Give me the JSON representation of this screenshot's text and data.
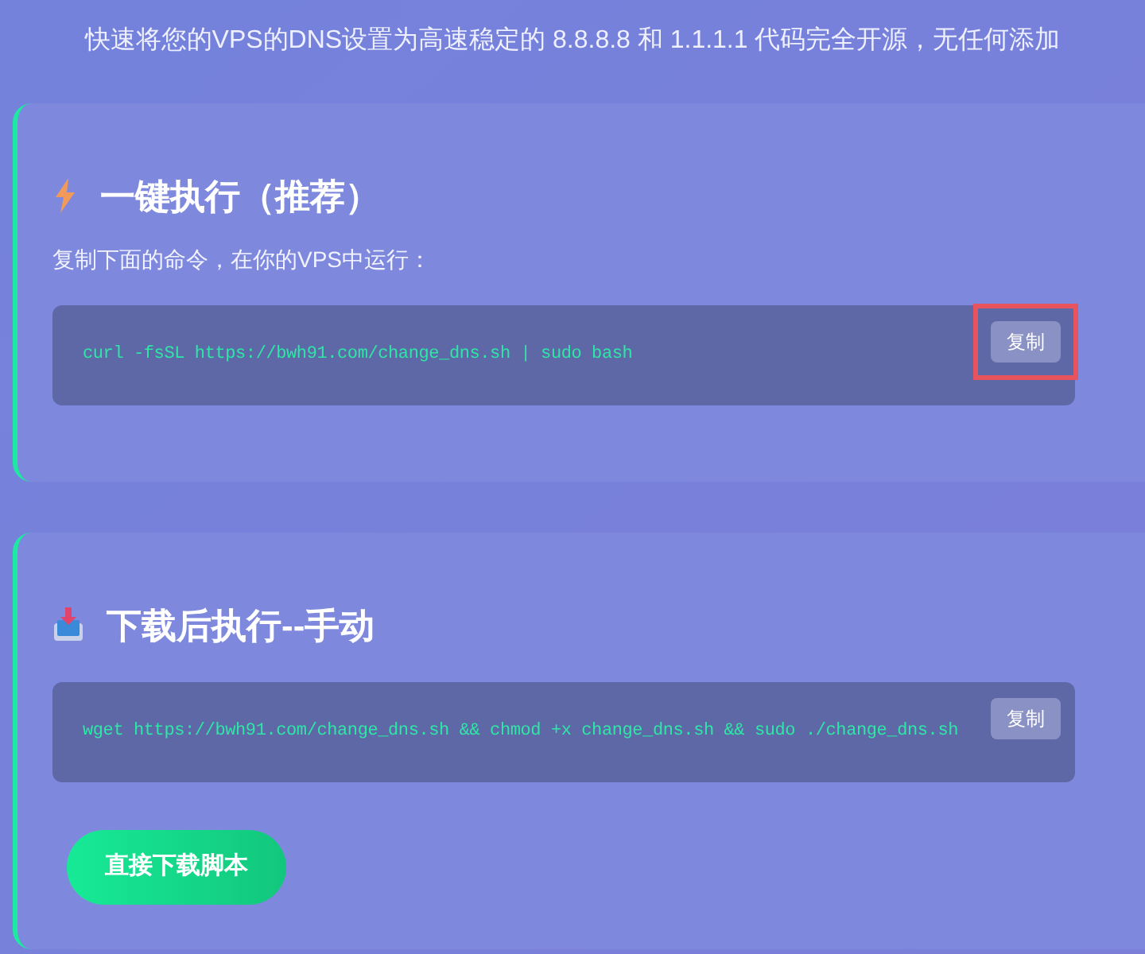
{
  "subtitle": "快速将您的VPS的DNS设置为高速稳定的 8.8.8.8 和 1.1.1.1 代码完全开源，无任何添加",
  "sections": [
    {
      "kind": "oneclick",
      "title": "一键执行（推荐）",
      "description": "复制下面的命令，在你的VPS中运行：",
      "command": "curl -fsSL https://bwh91.com/change_dns.sh | sudo bash",
      "copy": {
        "label": "复制",
        "highlighted": true
      }
    },
    {
      "kind": "manual",
      "title": "下载后执行--手动",
      "command": "wget https://bwh91.com/change_dns.sh && chmod +x change_dns.sh && sudo ./change_dns.sh",
      "copy": {
        "label": "复制",
        "highlighted": false
      },
      "download_button": "直接下载脚本"
    }
  ]
}
